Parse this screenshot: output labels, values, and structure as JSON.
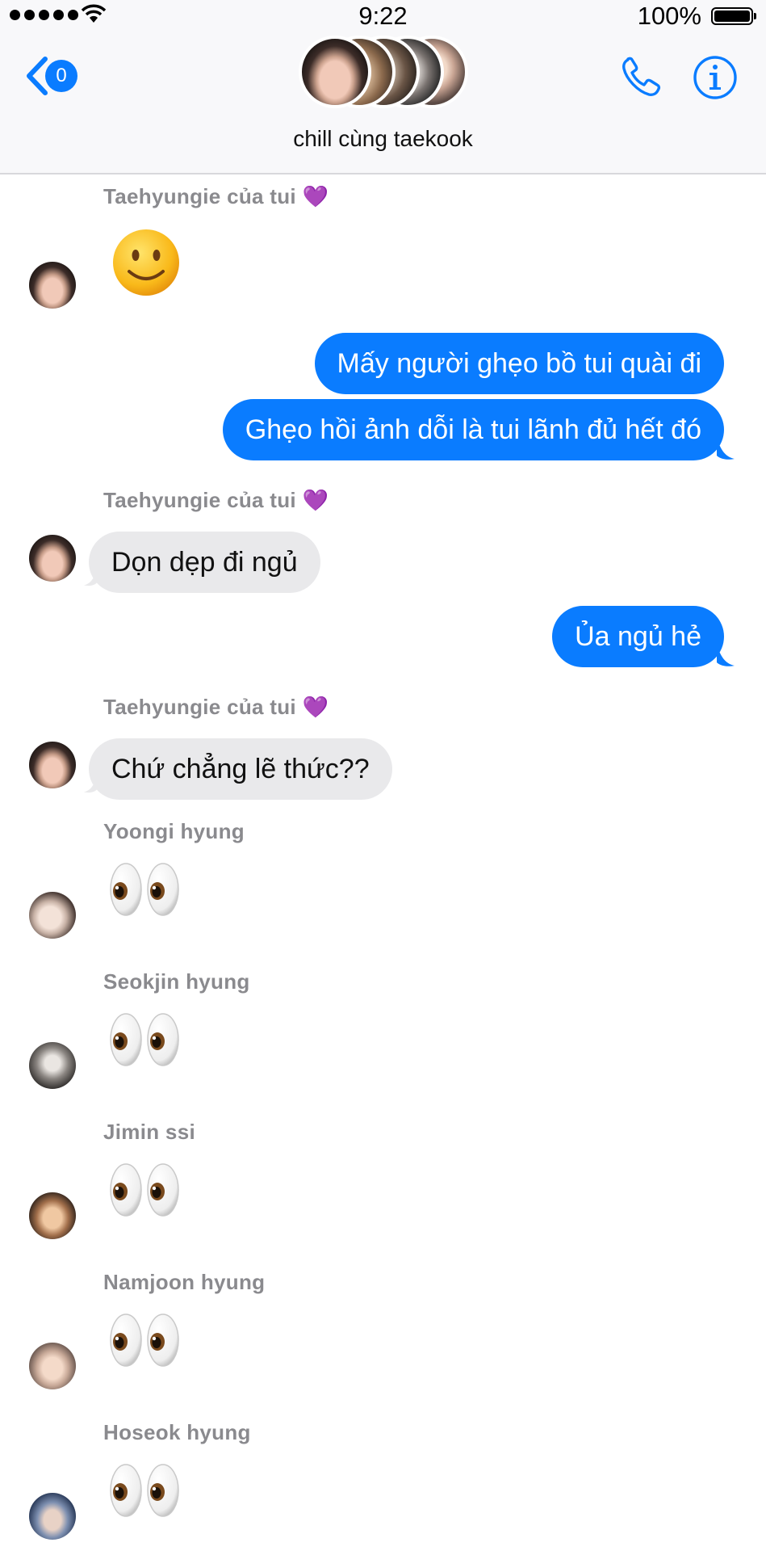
{
  "status_bar": {
    "time": "9:22",
    "battery": "100%"
  },
  "header": {
    "back_badge": "0",
    "title": "chill cùng taekook"
  },
  "messages": [
    {
      "sender": "Taehyungie của tui",
      "heart": "💜",
      "type": "emoji",
      "content": "smile"
    },
    {
      "type": "out",
      "text": "Mấy người ghẹo bồ tui quài đi"
    },
    {
      "type": "out",
      "text": "Ghẹo hồi ảnh dỗi là tui lãnh đủ hết đó"
    },
    {
      "sender": "Taehyungie của tui",
      "heart": "💜",
      "type": "in",
      "text": "Dọn dẹp đi ngủ"
    },
    {
      "type": "out",
      "text": "Ủa ngủ hẻ"
    },
    {
      "sender": "Taehyungie của tui",
      "heart": "💜",
      "type": "in",
      "text": "Chứ chẳng lẽ thức??"
    },
    {
      "sender": "Yoongi hyung",
      "type": "emoji",
      "content": "eyes"
    },
    {
      "sender": "Seokjin hyung",
      "type": "emoji",
      "content": "eyes"
    },
    {
      "sender": "Jimin ssi",
      "type": "emoji",
      "content": "eyes"
    },
    {
      "sender": "Namjoon hyung",
      "type": "emoji",
      "content": "eyes"
    },
    {
      "sender": "Hoseok hyung",
      "type": "emoji",
      "content": "eyes"
    }
  ],
  "colors": {
    "accent": "#0a7cff",
    "incoming_bubble": "#e9e9eb",
    "sender_label": "#8a8a8e"
  }
}
